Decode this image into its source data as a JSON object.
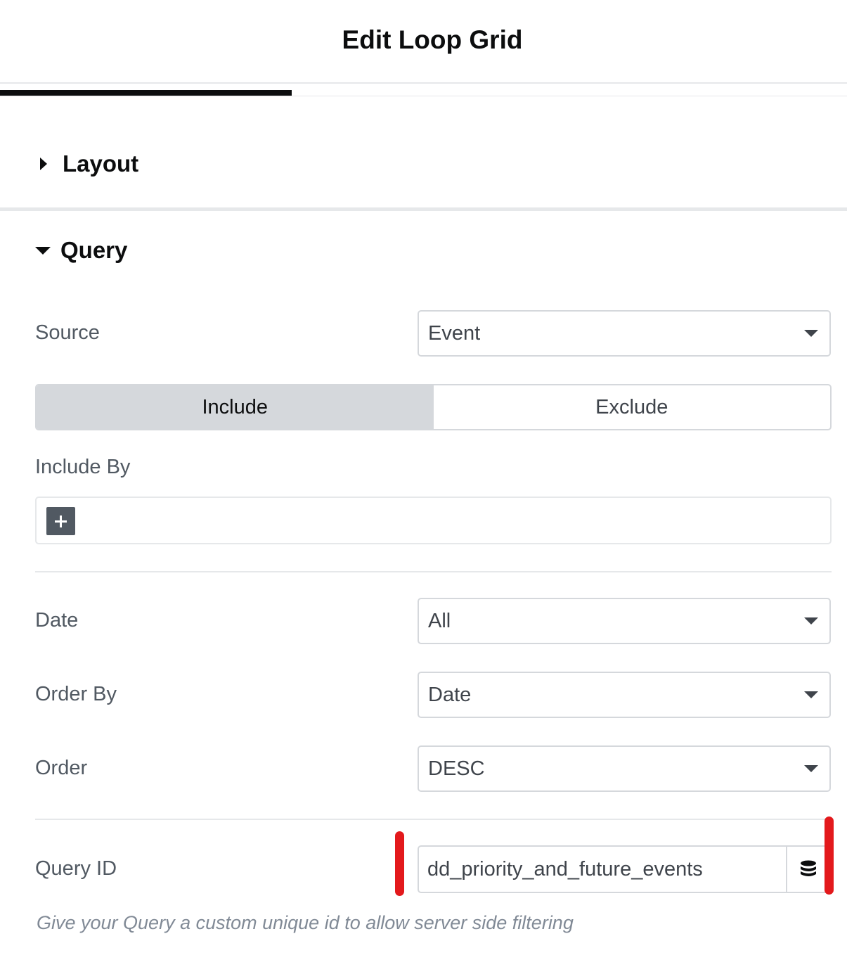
{
  "header": {
    "title": "Edit Loop Grid"
  },
  "sections": {
    "layout": {
      "label": "Layout"
    },
    "query": {
      "label": "Query"
    }
  },
  "fields": {
    "source": {
      "label": "Source",
      "value": "Event"
    },
    "include_switch": {
      "include": "Include",
      "exclude": "Exclude",
      "active": "Include"
    },
    "include_by": {
      "label": "Include By"
    },
    "date": {
      "label": "Date",
      "value": "All"
    },
    "order_by": {
      "label": "Order By",
      "value": "Date"
    },
    "order": {
      "label": "Order",
      "value": "DESC"
    },
    "query_id": {
      "label": "Query ID",
      "value": "dd_priority_and_future_events",
      "help": "Give your Query a custom unique id to allow server side filtering"
    }
  },
  "icons": {
    "layout_toggle": "caret-right-icon",
    "query_toggle": "caret-down-icon",
    "select_caret": "caret-down-icon",
    "add": "plus-icon",
    "dynamic_tags": "database-icon"
  },
  "colors": {
    "annotation": "#e3191c",
    "active_tab": "#0c0d0e",
    "switch_active_bg": "#d5d8dc"
  }
}
